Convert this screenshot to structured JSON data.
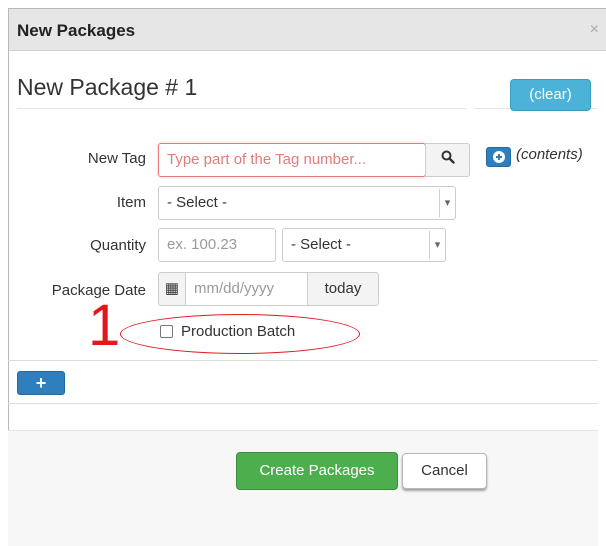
{
  "dialog": {
    "title": "New Packages",
    "close": "×",
    "heading": "New Package # 1",
    "clear_label": "(clear)",
    "contents_label": "(contents)"
  },
  "form": {
    "tag": {
      "label": "New Tag",
      "placeholder": "Type part of the Tag number...",
      "search_icon": "🔍"
    },
    "item": {
      "label": "Item",
      "selected": "- Select -"
    },
    "quantity": {
      "label": "Quantity",
      "placeholder": "ex. 100.23",
      "unit_selected": "- Select -"
    },
    "package_date": {
      "label": "Package Date",
      "placeholder": "mm/dd/yyyy",
      "today_label": "today",
      "calendar_icon": "▦"
    },
    "production_batch": {
      "label": "Production Batch",
      "checked": false
    }
  },
  "annotation": {
    "number": "1"
  },
  "actions": {
    "add_row": "+",
    "create_label": "Create Packages",
    "cancel_label": "Cancel"
  },
  "colors": {
    "accent_info": "#4cb2d8",
    "primary": "#2f7fbf",
    "success": "#4cae4c",
    "annotation_red": "#e0191f"
  }
}
